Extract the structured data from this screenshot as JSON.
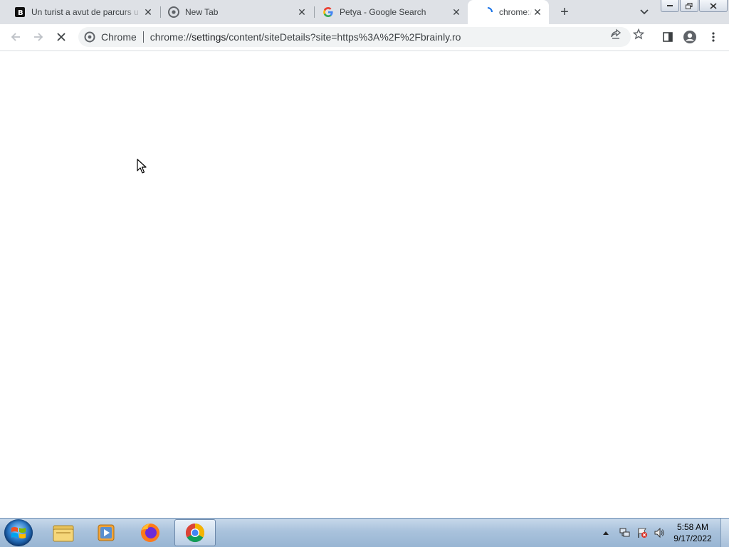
{
  "browser": {
    "tabs": [
      {
        "title": "Un turist a avut de parcurs u",
        "favicon": "brainly-icon",
        "active": false
      },
      {
        "title": "New Tab",
        "favicon": "chrome-icon",
        "active": false
      },
      {
        "title": "Petya - Google Search",
        "favicon": "google-icon",
        "active": false
      },
      {
        "title": "chrome://",
        "favicon": "loading-icon",
        "active": true
      }
    ],
    "new_tab_label": "+",
    "omnibox": {
      "chip_label": "Chrome",
      "url_scheme": "chrome://",
      "url_host": "settings",
      "url_path": "/content/siteDetails?site=https%3A%2F%2Fbrainly.ro"
    }
  },
  "taskbar": {
    "apps": [
      "windows-explorer",
      "media-player",
      "firefox",
      "chrome"
    ],
    "clock": {
      "time": "5:58 AM",
      "date": "9/17/2022"
    }
  },
  "colors": {
    "tabstrip_bg": "#dee1e6",
    "omnibox_bg": "#f1f3f4",
    "taskbar_bg": "#a9c2dc"
  }
}
